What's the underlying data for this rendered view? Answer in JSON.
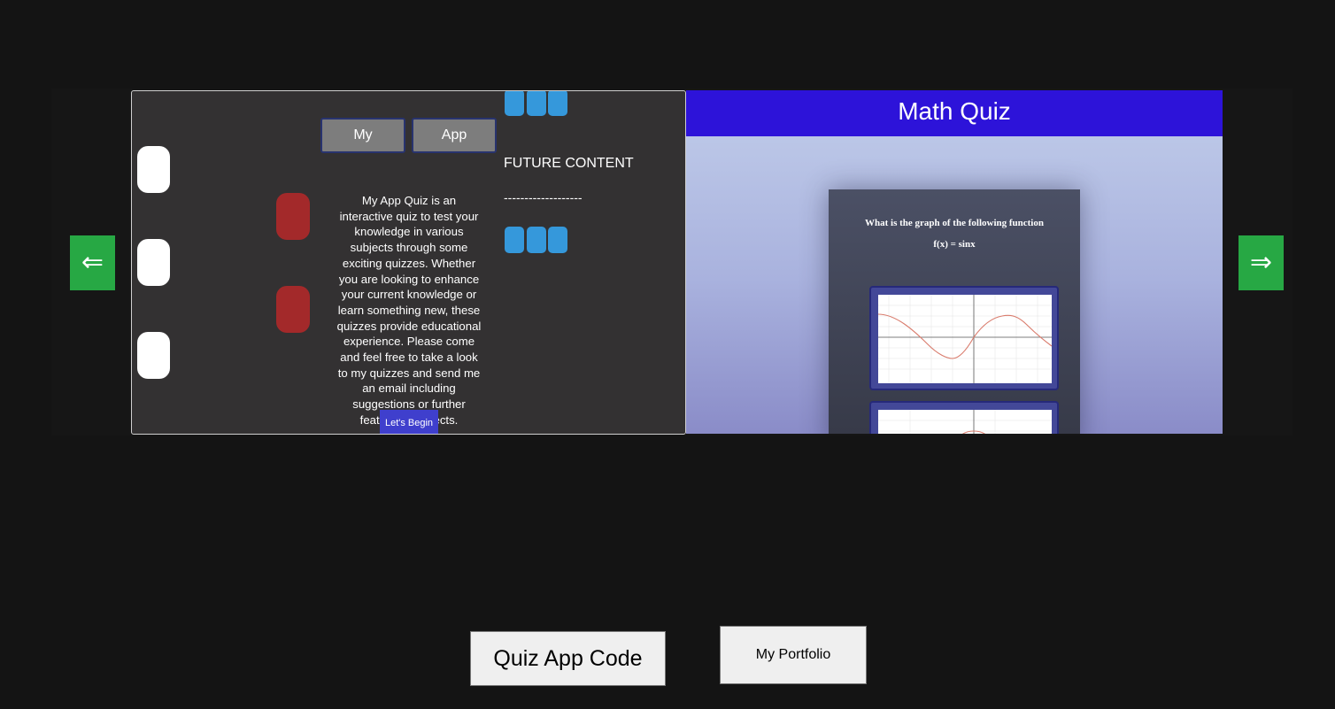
{
  "carousel": {
    "prev_label": "⇐",
    "next_label": "⇒"
  },
  "slide1": {
    "nav_left_label": "My",
    "nav_right_label": "App",
    "description": "My App Quiz is an interactive quiz to test your knowledge in various subjects through some exciting quizzes. Whether you are looking to enhance your current knowledge or learn something new, these quizzes provide educational experience. Please come and feel free to take a look to my quizzes and send me an email including suggestions or further features / subjects.",
    "begin_label": "Let's Begin",
    "future_title": "FUTURE CONTENT",
    "future_dashes": "-------------------"
  },
  "slide2": {
    "header": "Math Quiz",
    "question": "What is the graph of the following function",
    "function": "f(x) = sinx"
  },
  "footer": {
    "code_label": "Quiz App Code",
    "portfolio_label": "My Portfolio"
  },
  "colors": {
    "accent_green": "#27a844",
    "quiz_header_blue": "#2d13d9",
    "begin_button": "#3f3fcd",
    "decor_red": "#a3292a",
    "decor_blue": "#3598db"
  }
}
